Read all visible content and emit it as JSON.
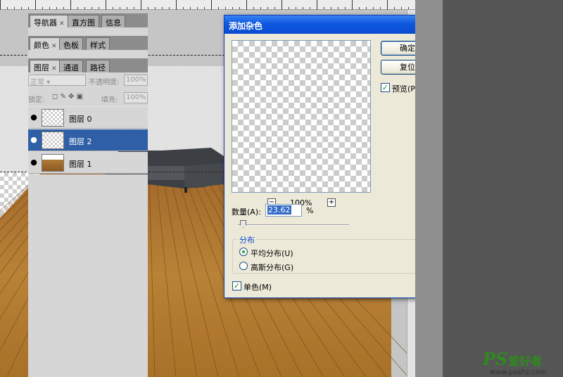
{
  "dialog": {
    "title": "添加杂色",
    "ok_label": "确定",
    "reset_label": "复位",
    "preview_label": "预览(P)",
    "preview_checked": true,
    "zoom": "100%",
    "amount_label": "数量(A):",
    "amount_value": "23.62",
    "amount_unit": "%",
    "distribution_legend": "分布",
    "uniform_label": "平均分布(U)",
    "gaussian_label": "高斯分布(G)",
    "selected_distribution": "uniform",
    "monochromatic_label": "单色(M)",
    "monochromatic_checked": true
  },
  "panels": {
    "top_tabs": [
      {
        "label": "导航器",
        "closable": true
      },
      {
        "label": "直方图",
        "closable": false
      },
      {
        "label": "信息",
        "closable": false
      }
    ],
    "mid_tabs": [
      {
        "label": "颜色",
        "closable": true
      },
      {
        "label": "色板",
        "closable": false
      },
      {
        "label": "样式",
        "closable": false
      }
    ],
    "layer_tabs": [
      {
        "label": "图层",
        "closable": true
      },
      {
        "label": "通道",
        "closable": false
      },
      {
        "label": "路径",
        "closable": false
      }
    ],
    "blend_mode": "正常",
    "opacity_label": "不透明度:",
    "opacity_value": "100%",
    "lock_label": "锁定:",
    "fill_label": "填充:",
    "fill_value": "100%",
    "layers": [
      {
        "name": "图层 0",
        "selected": false,
        "visible": true
      },
      {
        "name": "图层 2",
        "selected": true,
        "visible": true
      },
      {
        "name": "图层 1",
        "selected": false,
        "visible": true
      }
    ]
  },
  "watermark": {
    "ps": "PS",
    "cn": "爱好者",
    "url": "www.psahz.com"
  }
}
